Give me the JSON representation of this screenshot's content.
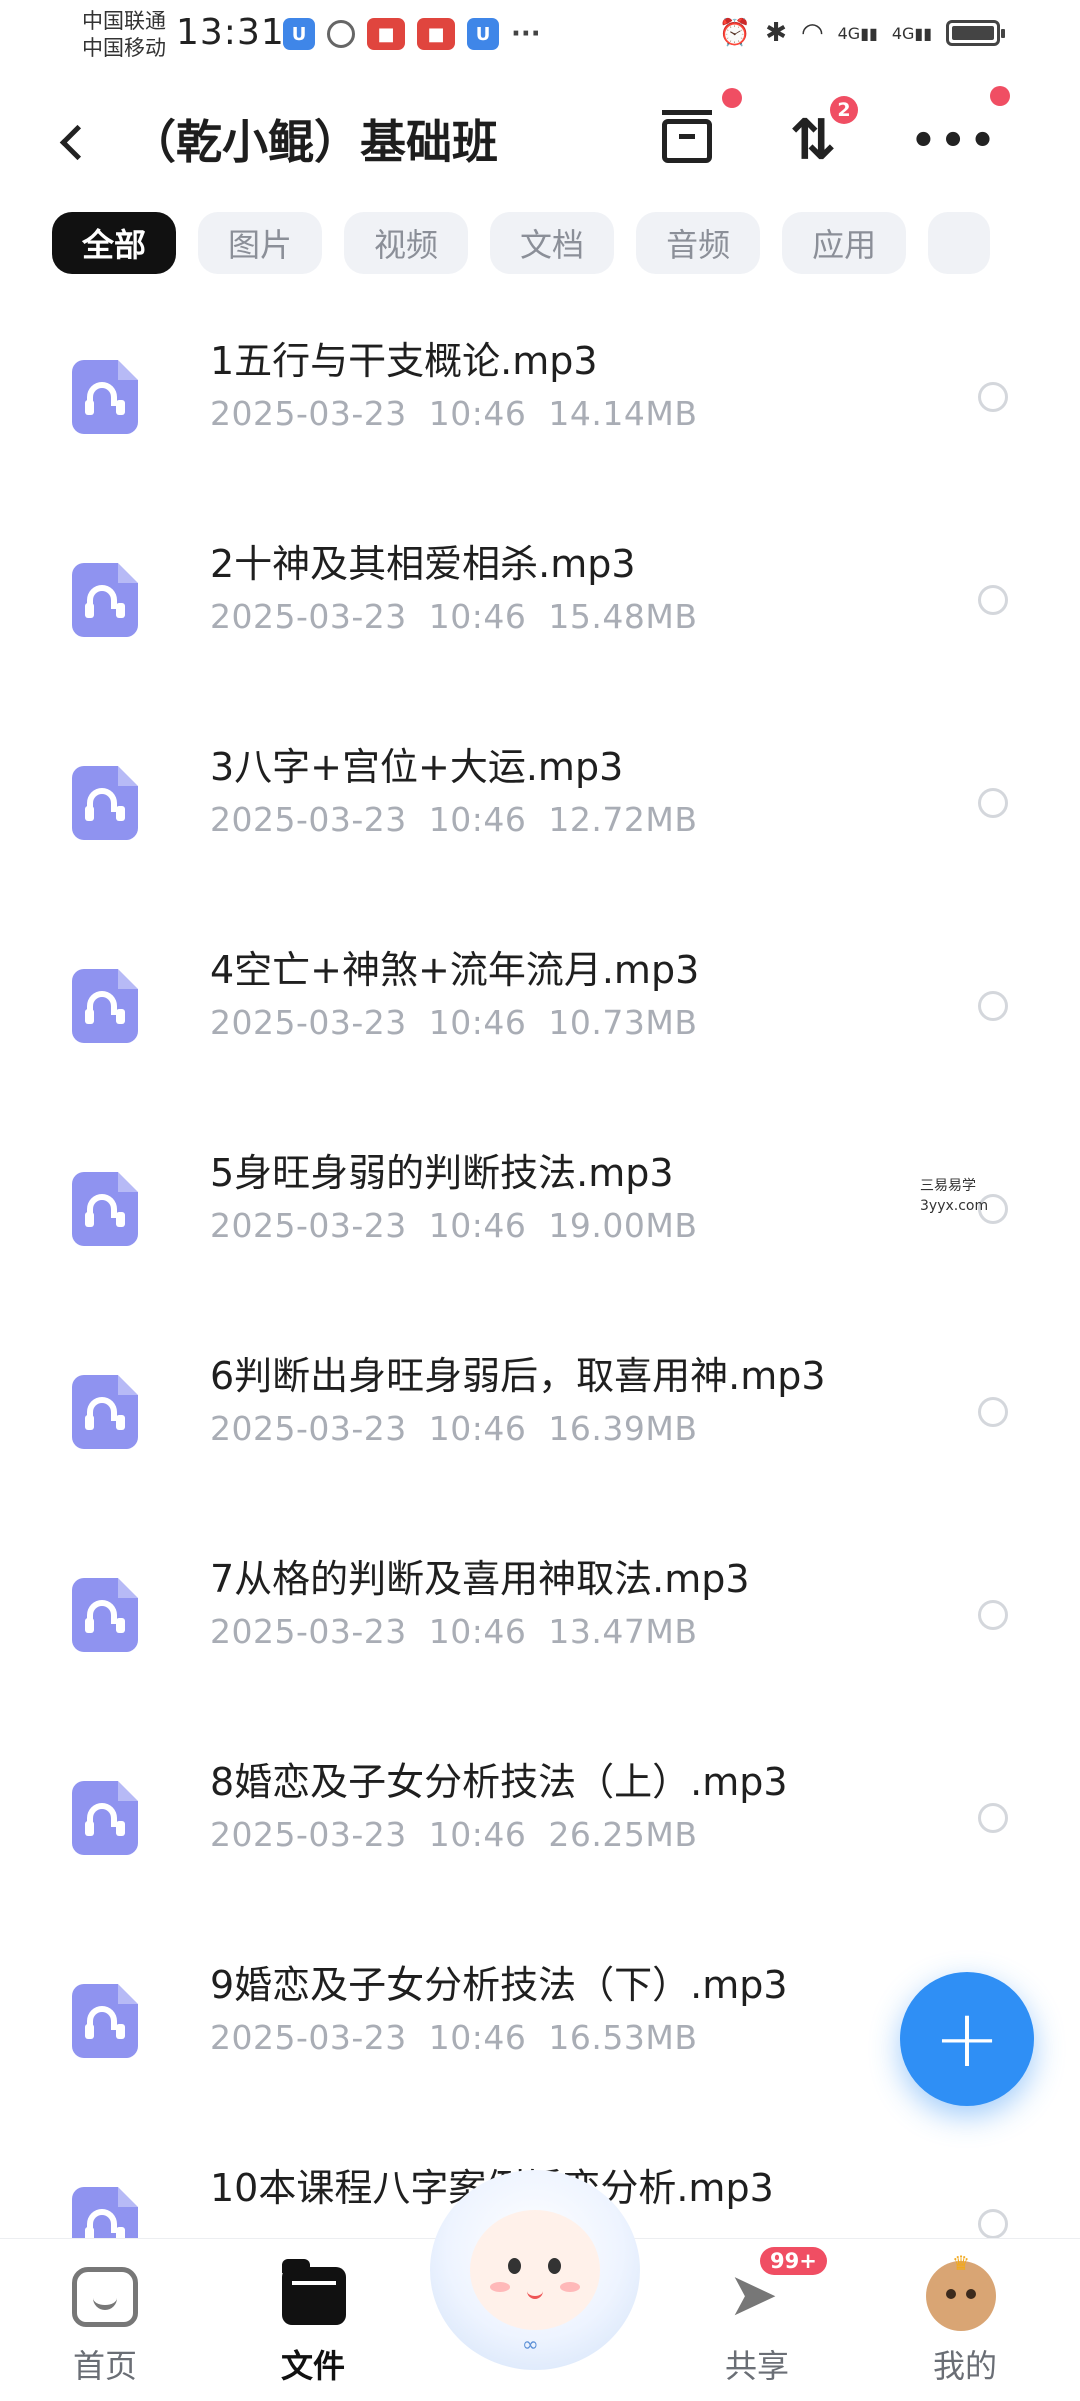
{
  "status_bar": {
    "carrier_1": "中国联通",
    "carrier_2": "中国移动",
    "time": "13:31",
    "more": "···",
    "network_1": "4G",
    "network_2": "4G"
  },
  "header": {
    "title": "（乾小鲲）基础班",
    "transfer_badge": "2"
  },
  "filter_chips": [
    "全部",
    "图片",
    "视频",
    "文档",
    "音频",
    "应用",
    ""
  ],
  "files": [
    {
      "name": "1五行与干支概论.mp3",
      "date": "2025-03-23",
      "time": "10:46",
      "size": "14.14MB"
    },
    {
      "name": "2十神及其相爱相杀.mp3",
      "date": "2025-03-23",
      "time": "10:46",
      "size": "15.48MB"
    },
    {
      "name": "3八字+宫位+大运.mp3",
      "date": "2025-03-23",
      "time": "10:46",
      "size": "12.72MB"
    },
    {
      "name": "4空亡+神煞+流年流月.mp3",
      "date": "2025-03-23",
      "time": "10:46",
      "size": "10.73MB"
    },
    {
      "name": "5身旺身弱的判断技法.mp3",
      "date": "2025-03-23",
      "time": "10:46",
      "size": "19.00MB"
    },
    {
      "name": "6判断出身旺身弱后，取喜用神.mp3",
      "date": "2025-03-23",
      "time": "10:46",
      "size": "16.39MB"
    },
    {
      "name": "7从格的判断及喜用神取法.mp3",
      "date": "2025-03-23",
      "time": "10:46",
      "size": "13.47MB"
    },
    {
      "name": "8婚恋及子女分析技法（上）.mp3",
      "date": "2025-03-23",
      "time": "10:46",
      "size": "26.25MB"
    },
    {
      "name": "9婚恋及子女分析技法（下）.mp3",
      "date": "2025-03-23",
      "time": "10:46",
      "size": "16.53MB"
    },
    {
      "name": "10本课程八字案例婚恋分析.mp3",
      "date": "",
      "time": "",
      "size": ""
    }
  ],
  "watermark": {
    "line1": "三易易学",
    "line2": "3yyx.com"
  },
  "fab": {
    "icon": "plus-icon",
    "symbol": "+"
  },
  "tabbar": {
    "home": "首页",
    "files": "文件",
    "share": "共享",
    "share_badge": "99+",
    "me": "我的"
  },
  "colors": {
    "accent": "#2f8ff5",
    "file_icon": "#8f93f0",
    "badge": "#f04e63",
    "chip_active": "#111111"
  }
}
